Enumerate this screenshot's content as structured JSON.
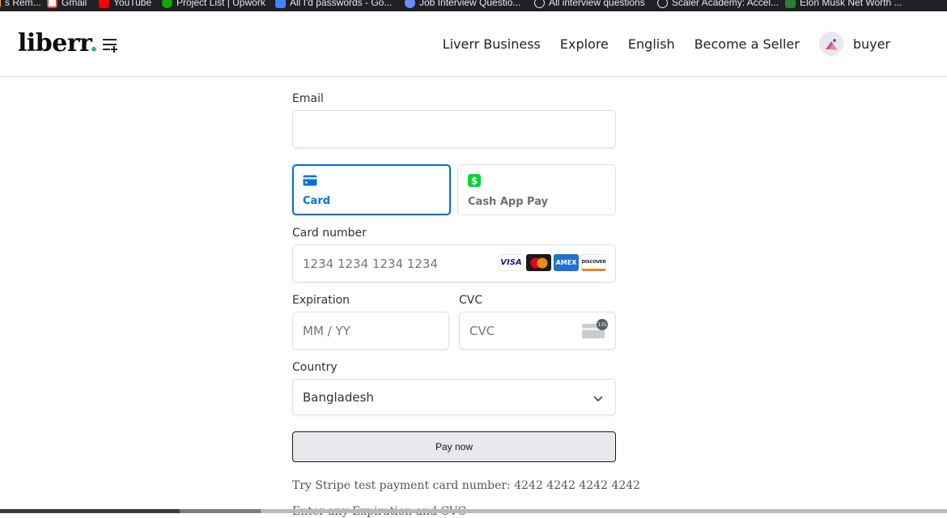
{
  "bookmarks": [
    {
      "label": "s Rem...",
      "color": "#f2a33a"
    },
    {
      "label": "Gmail",
      "color": "#ea4335"
    },
    {
      "label": "YouTube",
      "color": "#ff0000"
    },
    {
      "label": "Project List | Upwork",
      "color": "#14a800"
    },
    {
      "label": "All I'd passwords - Go...",
      "color": "#4285f4"
    },
    {
      "label": "Job Interview Questio...",
      "color": "#6b8cff"
    },
    {
      "label": "All interview questions",
      "color": "#9aa0a6"
    },
    {
      "label": "Scaler Academy: Accel...",
      "color": "#9aa0a6"
    },
    {
      "label": "Elon Musk Net Worth ...",
      "color": "#2e7d32"
    }
  ],
  "header": {
    "logo_text": "liberr",
    "logo_dot": ".",
    "nav": {
      "business": "Liverr Business",
      "explore": "Explore",
      "language": "English",
      "become_seller": "Become a Seller"
    },
    "user_name": "buyer"
  },
  "form": {
    "email_label": "Email",
    "email_value": "",
    "tabs": [
      {
        "label": "Card",
        "icon": "credit-card-icon",
        "active": true
      },
      {
        "label": "Cash App Pay",
        "icon": "cash-app-icon",
        "active": false
      }
    ],
    "card_number_label": "Card number",
    "card_number_placeholder": "1234 1234 1234 1234",
    "card_brands": [
      "VISA",
      "mastercard",
      "AMEX",
      "DISCOVER"
    ],
    "expiration_label": "Expiration",
    "expiration_placeholder": "MM / YY",
    "cvc_label": "CVC",
    "cvc_placeholder": "CVC",
    "cvc_badge": "135",
    "country_label": "Country",
    "country_value": "Bangladesh",
    "pay_button": "Pay now"
  },
  "hints": {
    "test_card": "Try Stripe test payment card number: 4242 4242 4242 4242",
    "expiration_cvc": "Enter any Expiration and CVC"
  },
  "colors": {
    "accent": "#0570de",
    "brand_green": "#1dbf73",
    "cash_app_green": "#00d632"
  }
}
